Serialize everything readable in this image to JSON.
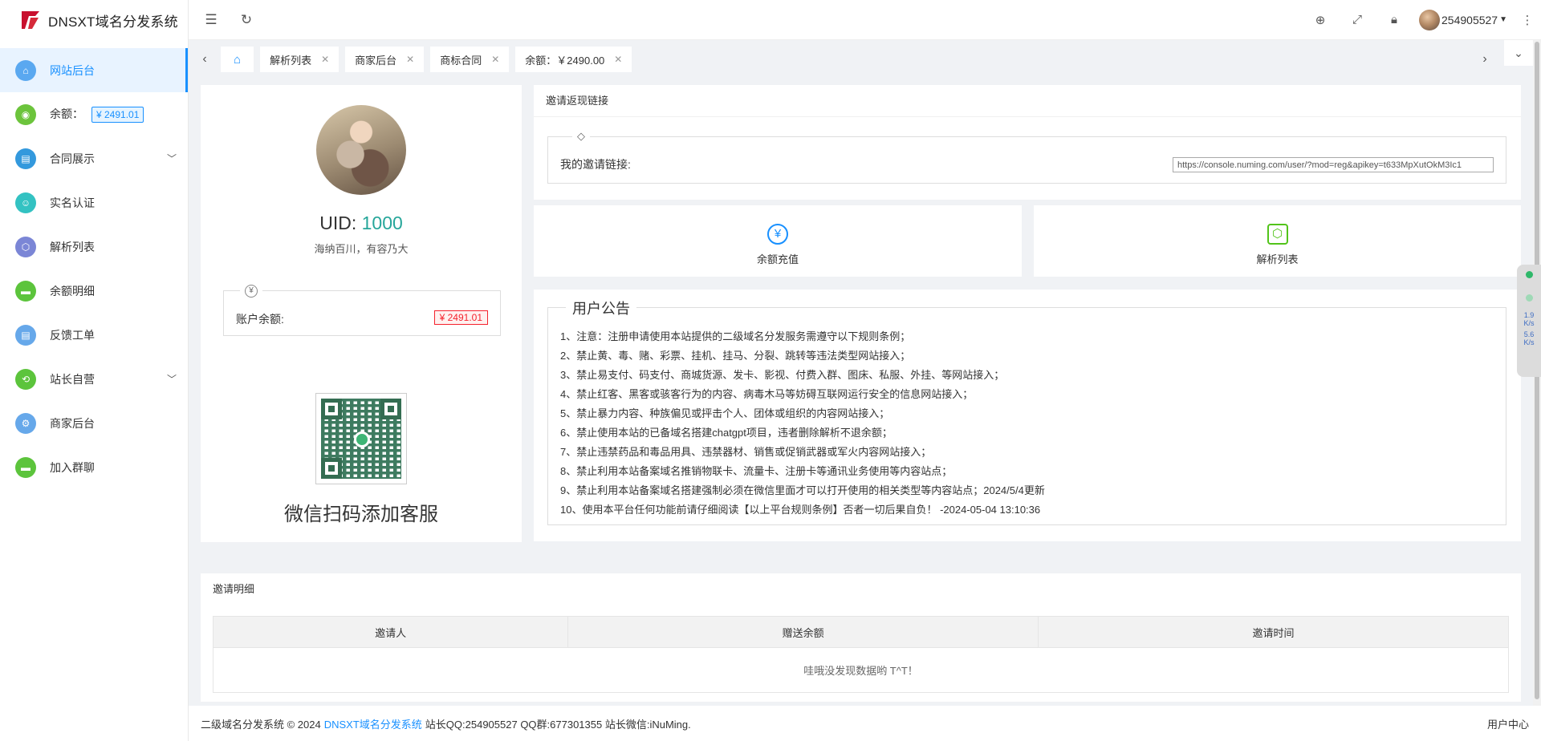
{
  "app": {
    "title": "DNSXT域名分发系统"
  },
  "sidebar": {
    "items": [
      {
        "label": "网站后台",
        "icon": "home-icon",
        "color": "#5aa8f0",
        "active": true
      },
      {
        "label": "余额：",
        "icon": "coin-icon",
        "color": "#6cc43c",
        "badge": "¥ 2491.01"
      },
      {
        "label": "合同展示",
        "icon": "contract-icon",
        "color": "#3399dd",
        "chevron": true
      },
      {
        "label": "实名认证",
        "icon": "id-icon",
        "color": "#33c2c2"
      },
      {
        "label": "解析列表",
        "icon": "cube-icon",
        "color": "#7b86d6"
      },
      {
        "label": "余额明细",
        "icon": "chat-icon",
        "color": "#5cc43c"
      },
      {
        "label": "反馈工单",
        "icon": "ticket-icon",
        "color": "#66a8ea"
      },
      {
        "label": "站长自营",
        "icon": "store-icon",
        "color": "#5cc43c",
        "chevron": true
      },
      {
        "label": "商家后台",
        "icon": "gear-icon",
        "color": "#66a8ea"
      },
      {
        "label": "加入群聊",
        "icon": "chat-icon",
        "color": "#5cc43c"
      }
    ]
  },
  "topbar": {
    "username": "254905527"
  },
  "tabs": [
    {
      "label": "解析列表"
    },
    {
      "label": "商家后台"
    },
    {
      "label": "商标合同"
    },
    {
      "label": "余额：￥2490.00"
    }
  ],
  "profile": {
    "uid_label": "UID:",
    "uid": "1000",
    "motto": "海纳百川，有容乃大",
    "balance_label": "账户余额:",
    "balance": "¥ 2491.01",
    "wechat_title": "微信扫码添加客服"
  },
  "invite": {
    "header": "邀请返现链接",
    "label": "我的邀请链接:",
    "url": "https://console.numing.com/user/?mod=reg&apikey=t633MpXutOkM3Ic1"
  },
  "quick": [
    {
      "label": "余额充值",
      "symbol": "¥"
    },
    {
      "label": "解析列表",
      "symbol": "⬡"
    }
  ],
  "notice": {
    "title": "用户公告",
    "items": [
      "1、注意：注册申请使用本站提供的二级域名分发服务需遵守以下规则条例；",
      "2、禁止黄、毒、赌、彩票、挂机、挂马、分裂、跳转等违法类型网站接入；",
      "3、禁止易支付、码支付、商城货源、发卡、影视、付费入群、图床、私服、外挂、等网站接入；",
      "4、禁止红客、黑客或骇客行为的内容、病毒木马等妨碍互联网运行安全的信息网站接入；",
      "5、禁止暴力内容、种族偏见或抨击个人、团体或组织的内容网站接入；",
      "6、禁止使用本站的已备域名搭建chatgpt项目，违者删除解析不退余额；",
      "7、禁止违禁药品和毒品用具、违禁器材、销售或促销武器或军火内容网站接入；",
      "8、禁止利用本站备案域名推销物联卡、流量卡、注册卡等通讯业务使用等内容站点；",
      "9、禁止利用本站备案域名搭建强制必须在微信里面才可以打开使用的相关类型等内容站点；2024/5/4更新",
      "10、使用本平台任何功能前请仔细阅读【以上平台规则条例】否者一切后果自负！ -2024-05-04 13:10:36"
    ]
  },
  "detail": {
    "header": "邀请明细",
    "columns": [
      "邀请人",
      "赠送余额",
      "邀请时间"
    ],
    "empty": "哇哦没发现数据哟 T^T！"
  },
  "footer": {
    "prefix": "二级域名分发系统 © 2024",
    "link": "DNSXT域名分发系统",
    "suffix": "站长QQ:254905527 QQ群:677301355 站长微信:iNuMing.",
    "right": "用户中心"
  },
  "speed": {
    "up": "1.9",
    "up_unit": "K/s",
    "down": "5.6",
    "down_unit": "K/s"
  }
}
